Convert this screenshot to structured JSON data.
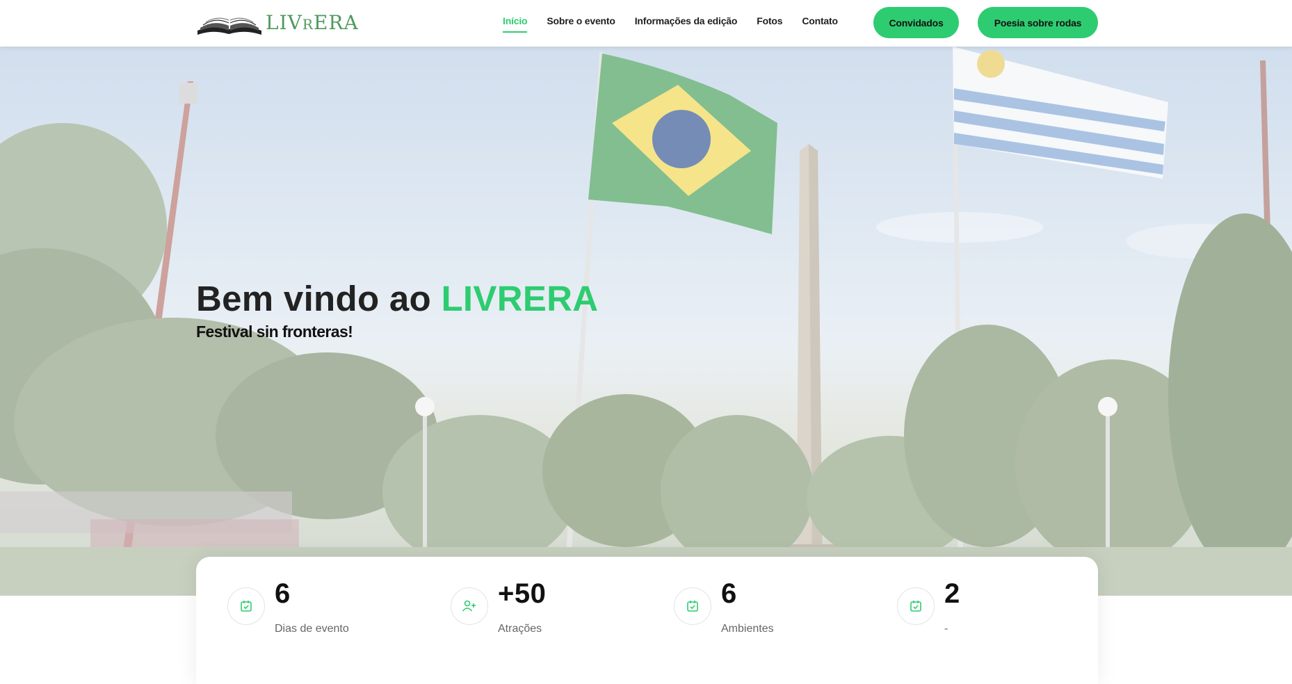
{
  "header": {
    "logo_text": {
      "first": "LIV",
      "small": "R",
      "rest": "ERA"
    },
    "nav": [
      {
        "label": "Início",
        "active": true
      },
      {
        "label": "Sobre o evento",
        "active": false
      },
      {
        "label": "Informações da edição",
        "active": false
      },
      {
        "label": "Fotos",
        "active": false
      },
      {
        "label": "Contato",
        "active": false
      }
    ],
    "buttons": {
      "guests": "Convidados",
      "poetry": "Poesia sobre rodas"
    }
  },
  "hero": {
    "title_prefix": "Bem vindo ao ",
    "title_accent": "LIVRERA",
    "subtitle": "Festival sin fronteras!"
  },
  "stats": [
    {
      "value": "6",
      "label": "Dias de evento",
      "icon": "calendar-check-icon"
    },
    {
      "value": "+50",
      "label": "Atrações",
      "icon": "user-plus-icon"
    },
    {
      "value": "6",
      "label": "Ambientes",
      "icon": "calendar-check-icon"
    },
    {
      "value": "2",
      "label": "-",
      "icon": "calendar-check-icon"
    }
  ],
  "colors": {
    "accent": "#2ecc71",
    "logo": "#4f9a5d",
    "text_dark": "#1f1f1f"
  }
}
